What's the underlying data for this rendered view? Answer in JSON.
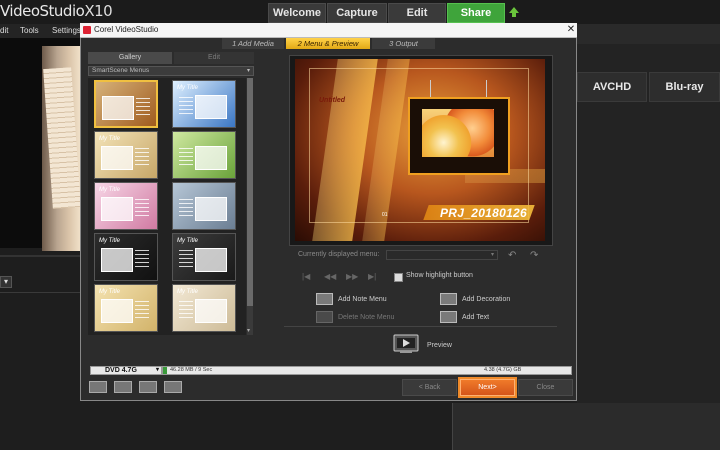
{
  "app": {
    "title": "VideoStudio",
    "version": "X10",
    "tabs": [
      "Welcome",
      "Capture",
      "Edit",
      "Share"
    ],
    "menu": [
      "dit",
      "Tools",
      "Settings"
    ],
    "right_buttons": [
      "AVCHD",
      "Blu-ray"
    ],
    "dropdown_glyph": "▾"
  },
  "dialog": {
    "title": "Corel VideoStudio",
    "close_glyph": "✕",
    "steps": [
      "1 Add Media",
      "2 Menu & Preview",
      "3 Output"
    ],
    "gallery_tabs": [
      "Gallery",
      "Edit"
    ],
    "gallery_dropdown": "SmartScene Menus",
    "dropdown_glyph": "▾",
    "gallery_scroll_down": "▾",
    "thumbnails": [
      {
        "label": "",
        "colors": [
          "#d6b27a",
          "#a05b1e"
        ]
      },
      {
        "label": "My Title",
        "colors": [
          "#dff0ff",
          "#3a76c4"
        ]
      },
      {
        "label": "My Title",
        "colors": [
          "#f3e3b8",
          "#c7a768"
        ]
      },
      {
        "label": "",
        "colors": [
          "#cfe8a0",
          "#6aa33a"
        ]
      },
      {
        "label": "My Title",
        "colors": [
          "#f7d6e6",
          "#d07aa2"
        ]
      },
      {
        "label": "",
        "colors": [
          "#b6c6d6",
          "#6b7e93"
        ]
      },
      {
        "label": "My Title",
        "colors": [
          "#2c2c2c",
          "#111111"
        ]
      },
      {
        "label": "My Title",
        "colors": [
          "#3c3c3c",
          "#1a1a1a"
        ]
      },
      {
        "label": "My Title",
        "colors": [
          "#f4e2b0",
          "#d2b36a"
        ]
      },
      {
        "label": "My Title",
        "colors": [
          "#f2e8d4",
          "#cdbb97"
        ]
      }
    ],
    "preview": {
      "untitled": "Untitled",
      "project": "PRJ_20180126",
      "number": "01"
    },
    "currently_displayed_menu_label": "Currently displayed menu:",
    "undo_glyph": "↶",
    "redo_glyph": "↷",
    "playback_glyphs": [
      "|◀",
      "◀◀",
      "▶▶",
      "▶|"
    ],
    "show_highlight_button": "Show highlight button",
    "actions": {
      "add_note_menu": "Add Note Menu",
      "delete_note_menu": "Delete Note Menu",
      "add_decoration": "Add Decoration",
      "add_text": "Add Text",
      "preview": "Preview"
    },
    "disc": {
      "type": "DVD 4.7G",
      "used": "46.28 MB / 9 Sec",
      "capacity": "4.38 (4.7G) GB",
      "used_fraction": 0.01
    },
    "buttons": {
      "back": "< Back",
      "next": "Next>",
      "close": "Close"
    }
  }
}
